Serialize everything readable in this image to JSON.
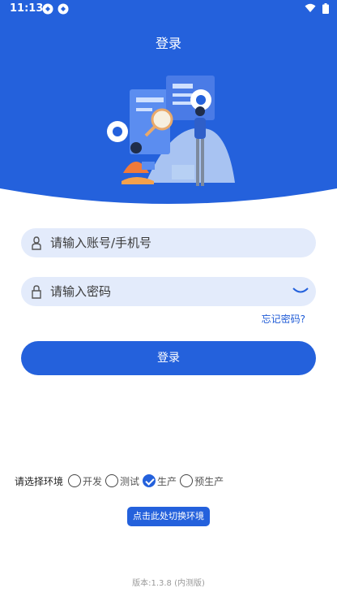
{
  "status_bar": {
    "time": "11:13"
  },
  "page": {
    "title": "登录"
  },
  "form": {
    "account_placeholder": "请输入账号/手机号",
    "password_placeholder": "请输入密码",
    "forgot_label": "忘记密码?",
    "login_label": "登录"
  },
  "environment": {
    "label": "请选择环境",
    "options": [
      {
        "label": "开发",
        "selected": false
      },
      {
        "label": "测试",
        "selected": false
      },
      {
        "label": "生产",
        "selected": true
      },
      {
        "label": "预生产",
        "selected": false
      }
    ],
    "switch_label": "点击此处切换环境"
  },
  "footer": {
    "version": "版本:1.3.8 (内测版)"
  },
  "colors": {
    "primary": "#2461dc",
    "field_bg": "#e3ebfb",
    "link": "#1f5bd6"
  },
  "icons": [
    "user-icon",
    "lock-icon",
    "eye-closed-icon",
    "wifi-icon",
    "battery-icon"
  ]
}
